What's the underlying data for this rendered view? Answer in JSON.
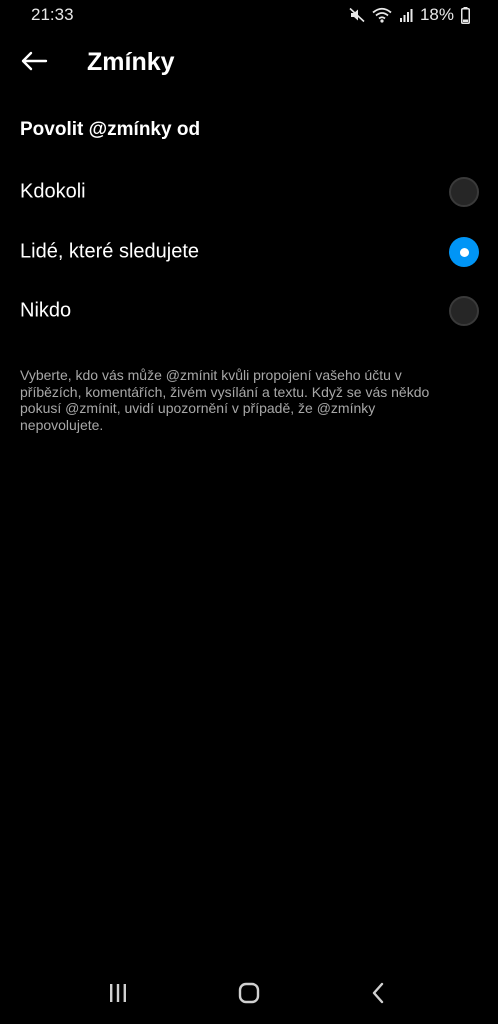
{
  "status_bar": {
    "time": "21:33",
    "battery_percent": "18%",
    "icons": [
      "mute-icon",
      "wifi-icon",
      "signal-icon",
      "battery-icon"
    ]
  },
  "header": {
    "title": "Zmínky",
    "back_icon": "arrow-left-icon"
  },
  "section": {
    "title": "Povolit @zmínky od"
  },
  "options": [
    {
      "label": "Kdokoli",
      "selected": false
    },
    {
      "label": "Lidé, které sledujete",
      "selected": true
    },
    {
      "label": "Nikdo",
      "selected": false
    }
  ],
  "description": "Vyberte, kdo vás může @zmínit kvůli propojení vašeho účtu v příbězích, komentářích, živém vysílání a textu. Když se vás někdo pokusí @zmínit, uvidí upozornění v případě, že @zmínky nepovolujete.",
  "nav_bar": {
    "icons": [
      "recent-apps-icon",
      "home-icon",
      "back-icon"
    ]
  },
  "colors": {
    "background": "#000000",
    "accent": "#0095f6",
    "secondary_text": "#a8a8a8"
  }
}
